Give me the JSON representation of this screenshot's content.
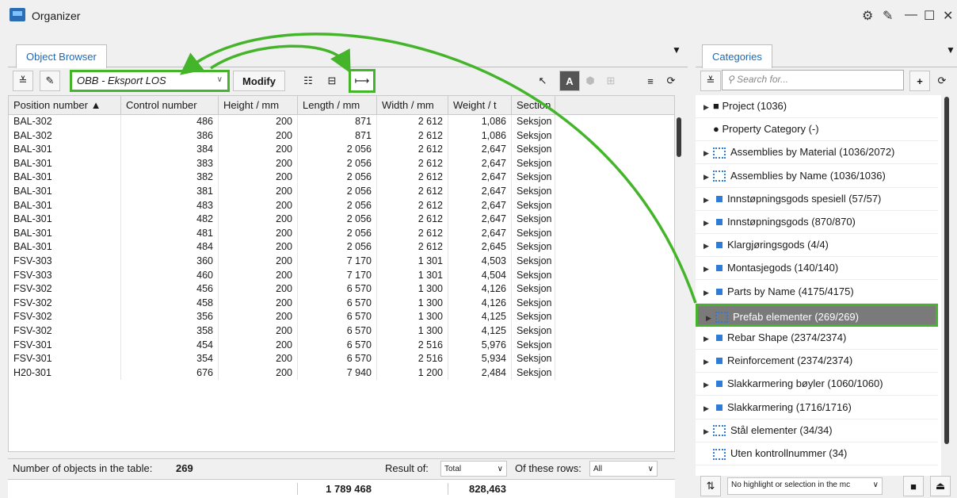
{
  "window": {
    "title": "Organizer",
    "controls": [
      "⚙",
      "✎",
      "—",
      "☐",
      "✕"
    ]
  },
  "left_panel": {
    "tab": "Object Browser",
    "dropdown_value": "OBB - Eksport LOS",
    "modify_label": "Modify",
    "columns": [
      "Position number",
      "Control number",
      "Height / mm",
      "Length / mm",
      "Width / mm",
      "Weight / t",
      "Section"
    ],
    "sort_indicator": "▲",
    "rows": [
      [
        "BAL-302",
        "486",
        "200",
        "871",
        "2 612",
        "1,086",
        "Seksjon"
      ],
      [
        "BAL-302",
        "386",
        "200",
        "871",
        "2 612",
        "1,086",
        "Seksjon"
      ],
      [
        "BAL-301",
        "384",
        "200",
        "2 056",
        "2 612",
        "2,647",
        "Seksjon"
      ],
      [
        "BAL-301",
        "383",
        "200",
        "2 056",
        "2 612",
        "2,647",
        "Seksjon"
      ],
      [
        "BAL-301",
        "382",
        "200",
        "2 056",
        "2 612",
        "2,647",
        "Seksjon"
      ],
      [
        "BAL-301",
        "381",
        "200",
        "2 056",
        "2 612",
        "2,647",
        "Seksjon"
      ],
      [
        "BAL-301",
        "483",
        "200",
        "2 056",
        "2 612",
        "2,647",
        "Seksjon"
      ],
      [
        "BAL-301",
        "482",
        "200",
        "2 056",
        "2 612",
        "2,647",
        "Seksjon"
      ],
      [
        "BAL-301",
        "481",
        "200",
        "2 056",
        "2 612",
        "2,647",
        "Seksjon"
      ],
      [
        "BAL-301",
        "484",
        "200",
        "2 056",
        "2 612",
        "2,645",
        "Seksjon"
      ],
      [
        "FSV-303",
        "360",
        "200",
        "7 170",
        "1 301",
        "4,503",
        "Seksjon"
      ],
      [
        "FSV-303",
        "460",
        "200",
        "7 170",
        "1 301",
        "4,504",
        "Seksjon"
      ],
      [
        "FSV-302",
        "456",
        "200",
        "6 570",
        "1 300",
        "4,126",
        "Seksjon"
      ],
      [
        "FSV-302",
        "458",
        "200",
        "6 570",
        "1 300",
        "4,126",
        "Seksjon"
      ],
      [
        "FSV-302",
        "356",
        "200",
        "6 570",
        "1 300",
        "4,125",
        "Seksjon"
      ],
      [
        "FSV-302",
        "358",
        "200",
        "6 570",
        "1 300",
        "4,125",
        "Seksjon"
      ],
      [
        "FSV-301",
        "454",
        "200",
        "6 570",
        "2 516",
        "5,976",
        "Seksjon"
      ],
      [
        "FSV-301",
        "354",
        "200",
        "6 570",
        "2 516",
        "5,934",
        "Seksjon"
      ],
      [
        "H20-301",
        "676",
        "200",
        "7 940",
        "1 200",
        "2,484",
        "Seksjon"
      ]
    ],
    "footer": {
      "count_label": "Number of objects in the table:",
      "count_value": "269",
      "result_label": "Result of:",
      "result_value": "Total",
      "rows_label": "Of these rows:",
      "rows_value": "All"
    },
    "totals": {
      "length": "1 789 468",
      "weight": "828,463"
    }
  },
  "right_panel": {
    "tab": "Categories",
    "search_placeholder": "Search for...",
    "categories": [
      {
        "label": "Project (1036)",
        "icon": "project",
        "arrow": "▶"
      },
      {
        "label": "Property Category (-)",
        "icon": "dot",
        "arrow": ""
      },
      {
        "label": "Assemblies by Material (1036/2072)",
        "icon": "assembly",
        "arrow": "▶"
      },
      {
        "label": "Assemblies by Name (1036/1036)",
        "icon": "assembly",
        "arrow": "▶"
      },
      {
        "label": "Innstøpningsgods spesiell (57/57)",
        "icon": "square",
        "arrow": "▶"
      },
      {
        "label": "Innstøpningsgods (870/870)",
        "icon": "square",
        "arrow": "▶"
      },
      {
        "label": "Klargjøringsgods (4/4)",
        "icon": "square",
        "arrow": "▶"
      },
      {
        "label": "Montasjegods (140/140)",
        "icon": "square",
        "arrow": "▶"
      },
      {
        "label": "Parts by Name (4175/4175)",
        "icon": "square",
        "arrow": "▶"
      },
      {
        "label": "Prefab elementer (269/269)",
        "icon": "assembly",
        "arrow": "▶",
        "selected": true
      },
      {
        "label": "Rebar Shape (2374/2374)",
        "icon": "square",
        "arrow": "▶"
      },
      {
        "label": "Reinforcement (2374/2374)",
        "icon": "square",
        "arrow": "▶"
      },
      {
        "label": "Slakkarmering bøyler (1060/1060)",
        "icon": "square",
        "arrow": "▶"
      },
      {
        "label": "Slakkarmering (1716/1716)",
        "icon": "square",
        "arrow": "▶"
      },
      {
        "label": "Stål elementer (34/34)",
        "icon": "assembly",
        "arrow": "▶"
      },
      {
        "label": "Uten kontrollnummer (34)",
        "icon": "assembly",
        "arrow": ""
      }
    ],
    "highlight_select": "No highlight or selection in the mc"
  },
  "colors": {
    "accent_green": "#44b52a",
    "tab_blue": "#1b69b6",
    "icon_blue": "#2f7bd6",
    "selected_row": "#7a7a7a"
  }
}
